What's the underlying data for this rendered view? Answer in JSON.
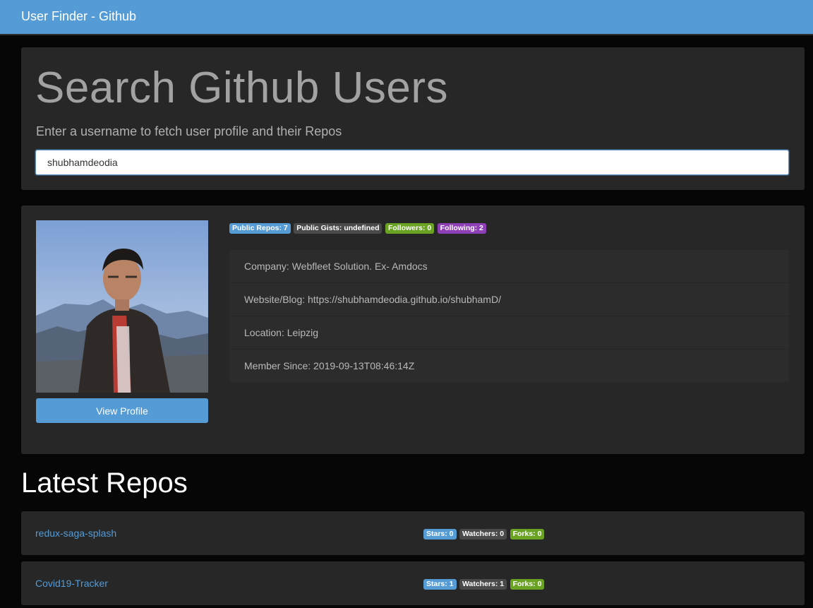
{
  "navbar": {
    "brand": "User Finder - Github"
  },
  "search": {
    "title": "Search Github Users",
    "subtitle": "Enter a username to fetch user profile and their Repos",
    "value": "shubhamdeodia"
  },
  "profile": {
    "view_profile_label": "View Profile",
    "badges": {
      "public_repos": "Public Repos: 7",
      "public_gists": "Public Gists: undefined",
      "followers": "Followers: 0",
      "following": "Following: 2"
    },
    "info": {
      "company": "Company: Webfleet Solution. Ex- Amdocs",
      "website": "Website/Blog: https://shubhamdeodia.github.io/shubhamD/",
      "location": "Location: Leipzig",
      "member_since": "Member Since: 2019-09-13T08:46:14Z"
    }
  },
  "repos": {
    "title": "Latest Repos",
    "items": [
      {
        "name": "redux-saga-splash",
        "stars": "Stars: 0",
        "watchers": "Watchers: 0",
        "forks": "Forks: 0"
      },
      {
        "name": "Covid19-Tracker",
        "stars": "Stars: 1",
        "watchers": "Watchers: 1",
        "forks": "Forks: 0"
      }
    ]
  },
  "colors": {
    "primary": "#559bd6",
    "panel": "#272727",
    "background": "#060606",
    "badge_gray": "#4a4a4a",
    "badge_green": "#6aa322",
    "badge_purple": "#8e3fb6"
  }
}
